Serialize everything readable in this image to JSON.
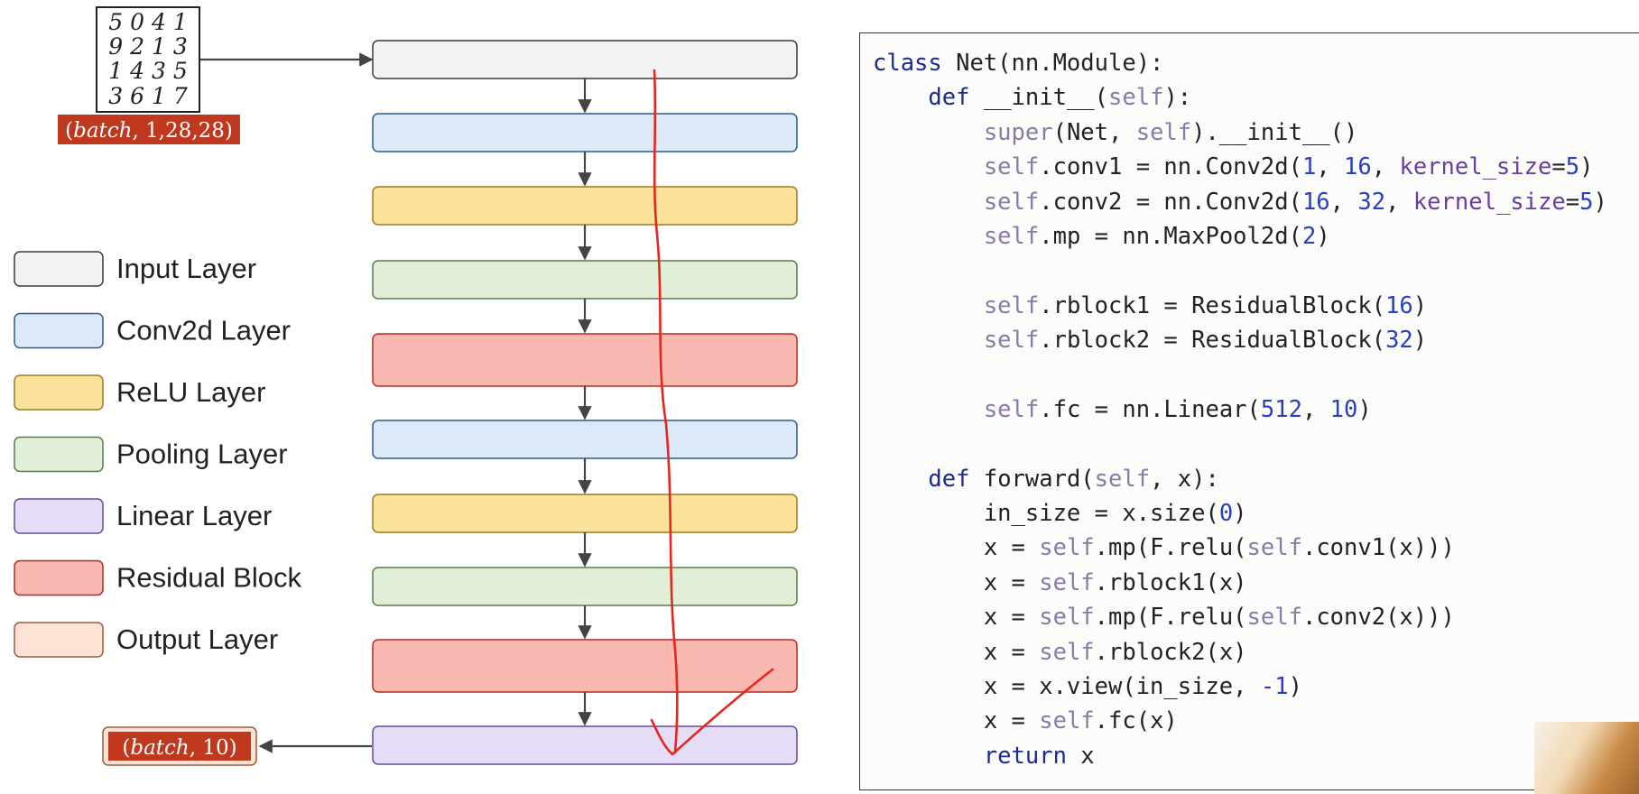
{
  "input_grid": {
    "rows": [
      "5 0 4 1",
      "9 2 1 3",
      "1 4 3 5",
      "3 6 1 7"
    ]
  },
  "input_shape": {
    "open": "(",
    "var": "batch",
    "rest": ", 1,28,28)"
  },
  "output_shape": {
    "open": "(",
    "var": "batch",
    "rest": ", 10)"
  },
  "legend": [
    {
      "label": "Input Layer",
      "fill": "#f2f2f2",
      "stroke": "#3a3a3a"
    },
    {
      "label": "Conv2d Layer",
      "fill": "#dbe9f8",
      "stroke": "#2d5a8a"
    },
    {
      "label": "ReLU Layer",
      "fill": "#fbe29a",
      "stroke": "#9a7a20"
    },
    {
      "label": "Pooling Layer",
      "fill": "#e1eed8",
      "stroke": "#5a7a4a"
    },
    {
      "label": "Linear Layer",
      "fill": "#e5dcf5",
      "stroke": "#6a4a9a"
    },
    {
      "label": "Residual Block",
      "fill": "#f9b9b1",
      "stroke": "#b52a1f"
    },
    {
      "label": "Output Layer",
      "fill": "#fde3d5",
      "stroke": "#a05a3a"
    }
  ],
  "layers": [
    {
      "kind": "input",
      "fill": "#f2f2f2",
      "stroke": "#3a3a3a"
    },
    {
      "kind": "conv2d",
      "fill": "#dbe9f8",
      "stroke": "#2d5a8a"
    },
    {
      "kind": "relu",
      "fill": "#fbe29a",
      "stroke": "#9a7a20"
    },
    {
      "kind": "pooling",
      "fill": "#e1eed8",
      "stroke": "#5a7a4a"
    },
    {
      "kind": "residual",
      "fill": "#f9b9b1",
      "stroke": "#b52a1f"
    },
    {
      "kind": "conv2d",
      "fill": "#dbe9f8",
      "stroke": "#2d5a8a"
    },
    {
      "kind": "relu",
      "fill": "#fbe29a",
      "stroke": "#9a7a20"
    },
    {
      "kind": "pooling",
      "fill": "#e1eed8",
      "stroke": "#5a7a4a"
    },
    {
      "kind": "residual",
      "fill": "#f9b9b1",
      "stroke": "#b52a1f"
    },
    {
      "kind": "linear",
      "fill": "#e5dcf5",
      "stroke": "#6a4a9a"
    }
  ],
  "colors": {
    "badge_fill": "#c0391f",
    "output_badge_fill": "#c0391f",
    "output_badge_border": "#fde3d5",
    "annotation": "#e8251e",
    "code_keyword": "#1c2c8c",
    "code_self": "#8a7aa8",
    "code_number": "#2a3fc0"
  },
  "code_lines": [
    [
      {
        "t": "class",
        "c": "kw"
      },
      {
        "t": " Net(nn.Module):"
      }
    ],
    [
      {
        "t": "    "
      },
      {
        "t": "def",
        "c": "kw"
      },
      {
        "t": " __init__("
      },
      {
        "t": "self",
        "c": "self"
      },
      {
        "t": "):"
      }
    ],
    [
      {
        "t": "        "
      },
      {
        "t": "super",
        "c": "self"
      },
      {
        "t": "(Net, "
      },
      {
        "t": "self",
        "c": "self"
      },
      {
        "t": ").__init__()"
      }
    ],
    [
      {
        "t": "        "
      },
      {
        "t": "self",
        "c": "self"
      },
      {
        "t": ".conv1 = nn.Conv2d("
      },
      {
        "t": "1",
        "c": "num"
      },
      {
        "t": ", "
      },
      {
        "t": "16",
        "c": "num"
      },
      {
        "t": ", "
      },
      {
        "t": "kernel_size",
        "c": "arg"
      },
      {
        "t": "="
      },
      {
        "t": "5",
        "c": "num"
      },
      {
        "t": ")"
      }
    ],
    [
      {
        "t": "        "
      },
      {
        "t": "self",
        "c": "self"
      },
      {
        "t": ".conv2 = nn.Conv2d("
      },
      {
        "t": "16",
        "c": "num"
      },
      {
        "t": ", "
      },
      {
        "t": "32",
        "c": "num"
      },
      {
        "t": ", "
      },
      {
        "t": "kernel_size",
        "c": "arg"
      },
      {
        "t": "="
      },
      {
        "t": "5",
        "c": "num"
      },
      {
        "t": ")"
      }
    ],
    [
      {
        "t": "        "
      },
      {
        "t": "self",
        "c": "self"
      },
      {
        "t": ".mp = nn.MaxPool2d("
      },
      {
        "t": "2",
        "c": "num"
      },
      {
        "t": ")"
      }
    ],
    [],
    [
      {
        "t": "        "
      },
      {
        "t": "self",
        "c": "self"
      },
      {
        "t": ".rblock1 = ResidualBlock("
      },
      {
        "t": "16",
        "c": "num"
      },
      {
        "t": ")"
      }
    ],
    [
      {
        "t": "        "
      },
      {
        "t": "self",
        "c": "self"
      },
      {
        "t": ".rblock2 = ResidualBlock("
      },
      {
        "t": "32",
        "c": "num"
      },
      {
        "t": ")"
      }
    ],
    [],
    [
      {
        "t": "        "
      },
      {
        "t": "self",
        "c": "self"
      },
      {
        "t": ".fc = nn.Linear("
      },
      {
        "t": "512",
        "c": "num"
      },
      {
        "t": ", "
      },
      {
        "t": "10",
        "c": "num"
      },
      {
        "t": ")"
      }
    ],
    [],
    [
      {
        "t": "    "
      },
      {
        "t": "def",
        "c": "kw"
      },
      {
        "t": " forward("
      },
      {
        "t": "self",
        "c": "self"
      },
      {
        "t": ", x):"
      }
    ],
    [
      {
        "t": "        in_size = x.size("
      },
      {
        "t": "0",
        "c": "num"
      },
      {
        "t": ")"
      }
    ],
    [
      {
        "t": "        x = "
      },
      {
        "t": "self",
        "c": "self"
      },
      {
        "t": ".mp(F.relu("
      },
      {
        "t": "self",
        "c": "self"
      },
      {
        "t": ".conv1(x)))"
      }
    ],
    [
      {
        "t": "        x = "
      },
      {
        "t": "self",
        "c": "self"
      },
      {
        "t": ".rblock1(x)"
      }
    ],
    [
      {
        "t": "        x = "
      },
      {
        "t": "self",
        "c": "self"
      },
      {
        "t": ".mp(F.relu("
      },
      {
        "t": "self",
        "c": "self"
      },
      {
        "t": ".conv2(x)))"
      }
    ],
    [
      {
        "t": "        x = "
      },
      {
        "t": "self",
        "c": "self"
      },
      {
        "t": ".rblock2(x)"
      }
    ],
    [
      {
        "t": "        x = x.view(in_size, "
      },
      {
        "t": "-1",
        "c": "num"
      },
      {
        "t": ")"
      }
    ],
    [
      {
        "t": "        x = "
      },
      {
        "t": "self",
        "c": "self"
      },
      {
        "t": ".fc(x)"
      }
    ],
    [
      {
        "t": "        "
      },
      {
        "t": "return",
        "c": "kw"
      },
      {
        "t": " x"
      }
    ]
  ]
}
